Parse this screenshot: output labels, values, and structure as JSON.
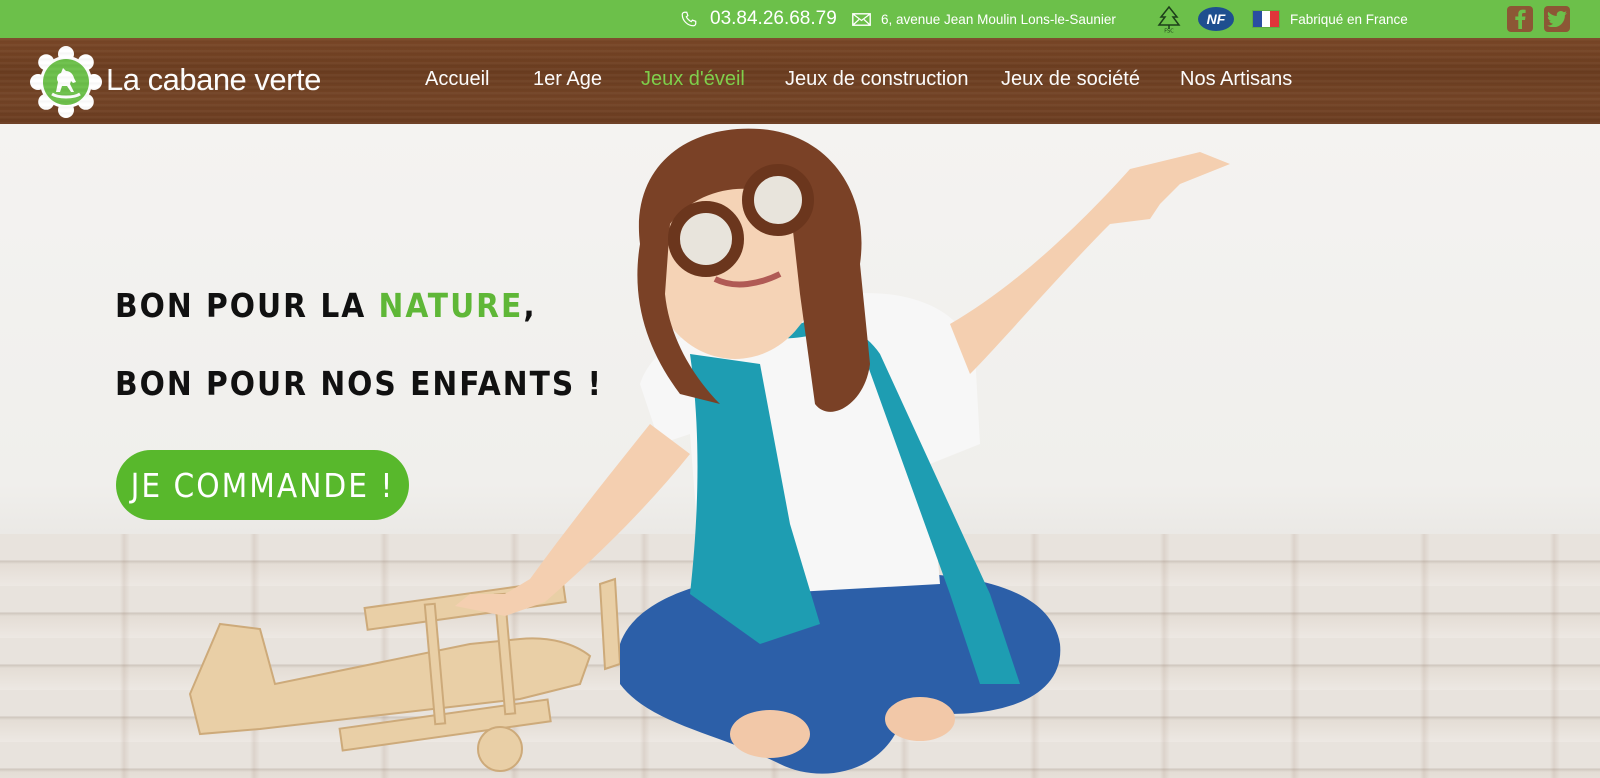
{
  "topbar": {
    "phone": "03.84.26.68.79",
    "address": "6, avenue Jean Moulin  Lons-le-Saunier",
    "fsc_label": "FSC",
    "nf_label": "NF",
    "made_in": "Fabriqué en France",
    "facebook_label": "f",
    "twitter_label": "t"
  },
  "header": {
    "brand": "La cabane verte",
    "nav": [
      "Accueil",
      "1er Age",
      "Jeux d'éveil",
      "Jeux de construction",
      "Jeux de société",
      "Nos Artisans"
    ],
    "active_nav": "Jeux d'éveil"
  },
  "hero": {
    "line1_prefix": "BON POUR LA ",
    "line1_highlight": "NATURE",
    "line1_suffix": ",",
    "line2": "BON POUR NOS ENFANTS !",
    "cta": "JE COMMANDE !"
  },
  "colors": {
    "topbar": "#6cc04a",
    "header": "#6f4022",
    "accent": "#58b82c",
    "active_nav": "#7fd14a"
  },
  "icons": [
    "phone-icon",
    "mail-icon",
    "fsc-tree-icon",
    "nf-logo-icon",
    "france-flag-icon",
    "facebook-icon",
    "twitter-icon",
    "logo-flower-horse-icon"
  ]
}
